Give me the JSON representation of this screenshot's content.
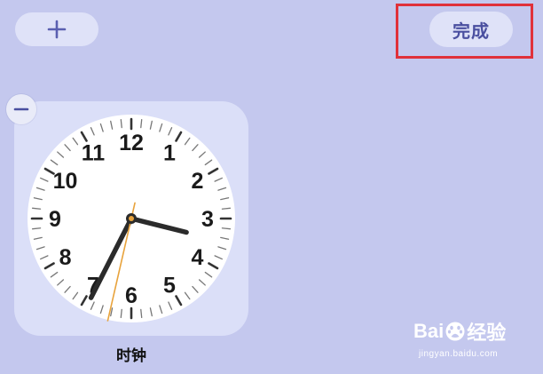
{
  "toolbar": {
    "add_icon": "plus-icon",
    "done_label": "完成"
  },
  "widget": {
    "label": "时钟",
    "remove_icon": "minus-icon",
    "clock": {
      "numbers": [
        "12",
        "1",
        "2",
        "3",
        "4",
        "5",
        "6",
        "7",
        "8",
        "9",
        "10",
        "11"
      ],
      "hour_angle_deg": 104,
      "minute_angle_deg": 207,
      "second_angle_deg": 193
    }
  },
  "watermark": {
    "logo_left": "Bai",
    "logo_right": "经验",
    "url": "jingyan.baidu.com"
  },
  "colors": {
    "background": "#c4c8ee",
    "pill": "#dfe2f8",
    "highlight": "#e0313a",
    "done_text": "#4a4fa0",
    "second_hand": "#e8a33c"
  }
}
